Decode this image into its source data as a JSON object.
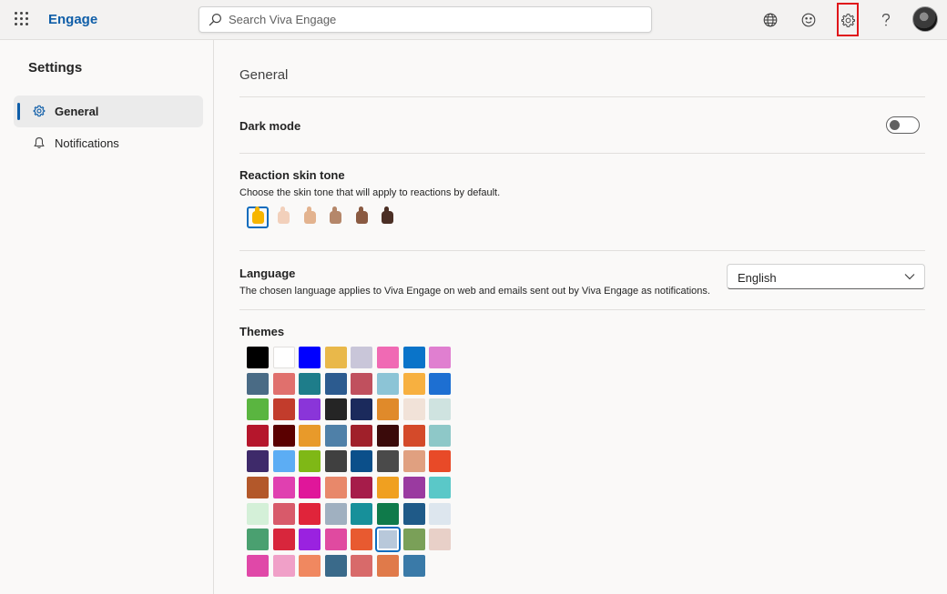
{
  "app": {
    "name": "Engage"
  },
  "search": {
    "placeholder": "Search Viva Engage"
  },
  "sidebar": {
    "title": "Settings",
    "items": [
      {
        "label": "General",
        "icon": "gear-icon",
        "active": true
      },
      {
        "label": "Notifications",
        "icon": "bell-icon",
        "active": false
      }
    ]
  },
  "general": {
    "heading": "General",
    "dark_mode": {
      "label": "Dark mode",
      "enabled": false
    },
    "skin_tone": {
      "label": "Reaction skin tone",
      "description": "Choose the skin tone that will apply to reactions by default.",
      "tones": [
        "#f7b500",
        "#f2d0bb",
        "#e3b38f",
        "#b5876a",
        "#8a5a42",
        "#4b2f25"
      ],
      "selected_index": 0
    },
    "language": {
      "label": "Language",
      "description": "The chosen language applies to Viva Engage on web and emails sent out by Viva Engage as notifications.",
      "selected": "English"
    },
    "themes": {
      "label": "Themes",
      "selected_index": 61,
      "colors": [
        "#000000",
        "#ffffff",
        "#0000ff",
        "#e9b84a",
        "#c9c6d9",
        "#f06ab4",
        "#0a74c9",
        "#e07fd0",
        "#4a6b85",
        "#e0706d",
        "#1e7d8a",
        "#2c5b8f",
        "#c0505e",
        "#8cc4d6",
        "#f7b040",
        "#1d6fd2",
        "#5ab540",
        "#c23c2c",
        "#8a35d9",
        "#252525",
        "#1b2a5c",
        "#e08a2a",
        "#f1e2d8",
        "#cfe3e0",
        "#b5162c",
        "#5a0000",
        "#e89a2a",
        "#4f80a8",
        "#a0202a",
        "#3a0a0a",
        "#d44a2a",
        "#8ec8c8",
        "#3e2a6a",
        "#5cadf4",
        "#7fb816",
        "#404040",
        "#0b4f8a",
        "#4a4a4a",
        "#e0a080",
        "#e84a28",
        "#b3582a",
        "#e040b0",
        "#e0169a",
        "#e8886a",
        "#a61c4a",
        "#f0a020",
        "#9a3aa0",
        "#5ac8c8",
        "#d4f0d8",
        "#d85a6a",
        "#e0243a",
        "#a0b0c0",
        "#17909a",
        "#0f7a4a",
        "#1f5a88",
        "#dde6ee",
        "#4aa070",
        "#d8263c",
        "#9a22e0",
        "#e04aa0",
        "#e85a30",
        "#b8c8da",
        "#7aa058",
        "#e8d0c8",
        "#e048a8",
        "#f0a0c8",
        "#f08860",
        "#3a6a8a",
        "#d86a6a",
        "#e07a4a",
        "#3a7aa8"
      ]
    }
  }
}
